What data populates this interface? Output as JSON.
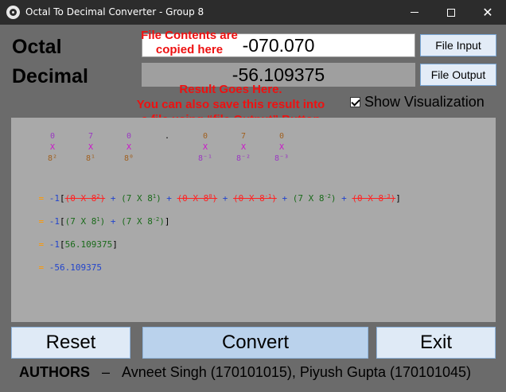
{
  "window": {
    "title": "Octal To Decimal Converter - Group 8"
  },
  "labels": {
    "octal": "Octal",
    "decimal": "Decimal"
  },
  "octal_input": {
    "value": "-070.070"
  },
  "decimal_output": {
    "value": "-56.109375"
  },
  "buttons": {
    "file_input": "File Input",
    "file_output": "File Output",
    "reset": "Reset",
    "convert": "Convert",
    "exit": "Exit"
  },
  "notes": {
    "file_contents": "File Contents are copied here",
    "result_line1": "Result Goes Here.",
    "result_line2": "You can also save this result into",
    "result_line3": "a file using “file Output” Button"
  },
  "visualization": {
    "toggle_label": "Show Visualization",
    "checked": true,
    "digits": [
      "0",
      "7",
      "0",
      ".",
      "0",
      "7",
      "0"
    ],
    "mul_symbol": "X",
    "bases": [
      "8²",
      "8¹",
      "8⁰",
      "",
      "8⁻¹",
      "8⁻²",
      "8⁻³"
    ],
    "steps": [
      "= -1[(0 X 8²) + (7 X 8¹) + (0 X 8⁰) + (0 X 8⁻¹) + (7 X 8⁻²) + (0 X 8⁻³)]",
      "= -1[(7 X 8¹) + (7 X 8⁻²)]",
      "= -1[56.109375]",
      "= -56.109375"
    ]
  },
  "authors": {
    "heading": "AUTHORS",
    "dash": "–",
    "names": "Avneet Singh (170101015), Piyush Gupta (170101045)"
  },
  "colors": {
    "accent_red": "#ee1111",
    "button_blue": "#bad2ec",
    "panel_gray": "#a9a9a9"
  }
}
